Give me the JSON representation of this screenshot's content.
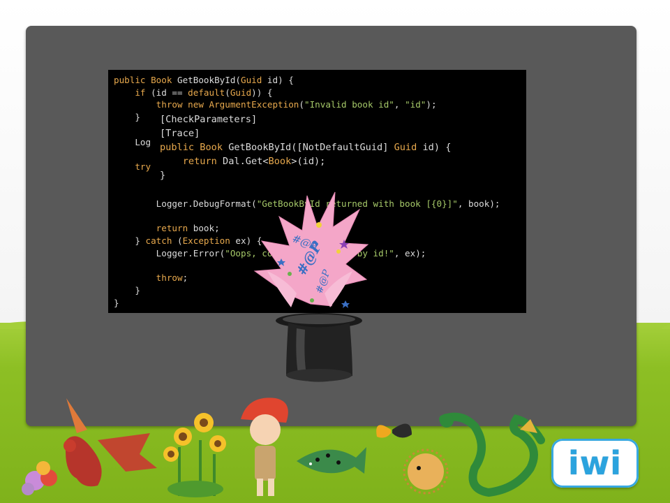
{
  "code": {
    "lines": [
      [
        {
          "t": "public ",
          "c": "kw"
        },
        {
          "t": "Book ",
          "c": "kw"
        },
        {
          "t": "GetBookById(",
          "c": "pl"
        },
        {
          "t": "Guid ",
          "c": "kw"
        },
        {
          "t": "id) {",
          "c": "pl"
        }
      ],
      [
        {
          "t": "    if ",
          "c": "kw"
        },
        {
          "t": "(id == ",
          "c": "pl"
        },
        {
          "t": "default",
          "c": "kw"
        },
        {
          "t": "(",
          "c": "pl"
        },
        {
          "t": "Guid",
          "c": "kw"
        },
        {
          "t": ")) {",
          "c": "pl"
        }
      ],
      [
        {
          "t": "        throw new ",
          "c": "kw"
        },
        {
          "t": "ArgumentException",
          "c": "kw"
        },
        {
          "t": "(",
          "c": "pl"
        },
        {
          "t": "\"Invalid book id\"",
          "c": "str"
        },
        {
          "t": ", ",
          "c": "pl"
        },
        {
          "t": "\"id\"",
          "c": "str"
        },
        {
          "t": ");",
          "c": "pl"
        }
      ],
      [
        {
          "t": "    }",
          "c": "pl"
        }
      ],
      [
        {
          "t": "",
          "c": "pl"
        }
      ],
      [
        {
          "t": "    Log",
          "c": "pl"
        }
      ],
      [
        {
          "t": "",
          "c": "pl"
        }
      ],
      [
        {
          "t": "    try",
          "c": "kw"
        }
      ],
      [
        {
          "t": "",
          "c": "pl"
        }
      ],
      [
        {
          "t": "",
          "c": "pl"
        }
      ],
      [
        {
          "t": "        Logger.DebugFormat(",
          "c": "pl"
        },
        {
          "t": "\"GetBookById returned with book [{0}]\"",
          "c": "str"
        },
        {
          "t": ", book);",
          "c": "pl"
        }
      ],
      [
        {
          "t": "",
          "c": "pl"
        }
      ],
      [
        {
          "t": "        return ",
          "c": "kw"
        },
        {
          "t": "book;",
          "c": "pl"
        }
      ],
      [
        {
          "t": "    } ",
          "c": "pl"
        },
        {
          "t": "catch ",
          "c": "kw"
        },
        {
          "t": "(",
          "c": "pl"
        },
        {
          "t": "Exception ",
          "c": "kw"
        },
        {
          "t": "ex) {",
          "c": "pl"
        }
      ],
      [
        {
          "t": "        Logger.Error(",
          "c": "pl"
        },
        {
          "t": "\"Oops, couldn't get book by id!\"",
          "c": "str"
        },
        {
          "t": ", ex);",
          "c": "pl"
        }
      ],
      [
        {
          "t": "",
          "c": "pl"
        }
      ],
      [
        {
          "t": "        throw",
          "c": "kw"
        },
        {
          "t": ";",
          "c": "pl"
        }
      ],
      [
        {
          "t": "    }",
          "c": "pl"
        }
      ],
      [
        {
          "t": "}",
          "c": "pl"
        }
      ]
    ]
  },
  "overlay": {
    "lines": [
      [
        {
          "t": "[CheckParameters]",
          "c": "pl"
        }
      ],
      [
        {
          "t": "[Trace]",
          "c": "pl"
        }
      ],
      [
        {
          "t": "public ",
          "c": "kw"
        },
        {
          "t": "Book ",
          "c": "kw"
        },
        {
          "t": "GetBookById([NotDefaultGuid] ",
          "c": "pl"
        },
        {
          "t": "Guid ",
          "c": "kw"
        },
        {
          "t": "id) {",
          "c": "pl"
        }
      ],
      [
        {
          "t": "    return ",
          "c": "kw"
        },
        {
          "t": "Dal.Get<",
          "c": "pl"
        },
        {
          "t": "Book",
          "c": "kw"
        },
        {
          "t": ">(id);",
          "c": "pl"
        }
      ],
      [
        {
          "t": "}",
          "c": "pl"
        }
      ]
    ]
  },
  "magic": {
    "burst_text": "#@P",
    "burst_color": "#f4a6c8",
    "hat_color": "#222222"
  },
  "logo": {
    "text": "iwi",
    "color": "#2ba3de"
  },
  "colors": {
    "slide": "#595959",
    "ground": "#8dbf24",
    "code_bg": "#000000",
    "keyword": "#e8a94d",
    "string": "#a6c969"
  }
}
